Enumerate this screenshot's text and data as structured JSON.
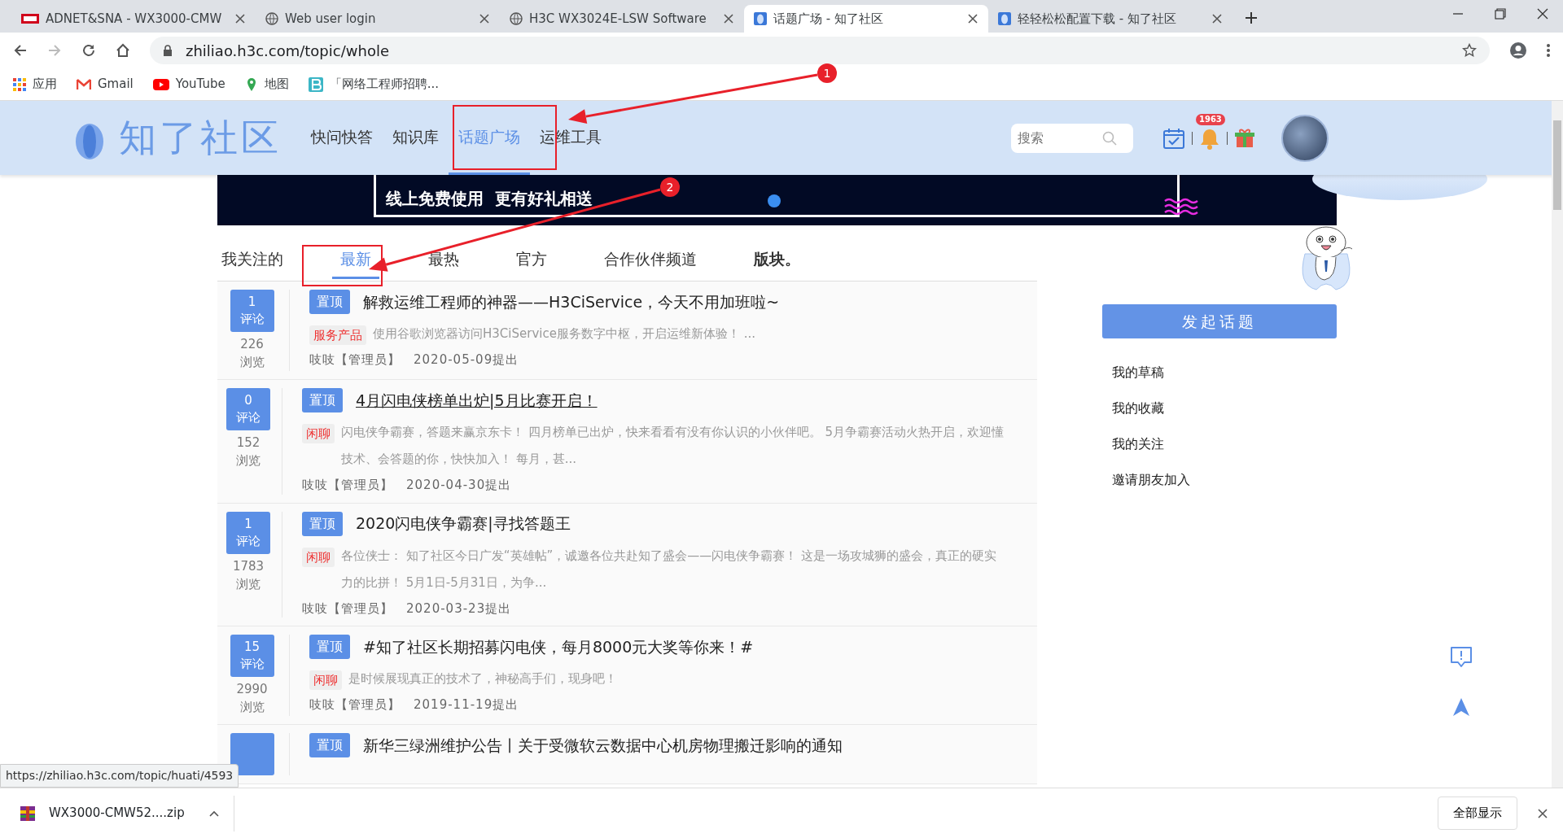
{
  "browser": {
    "tabs": [
      {
        "title": "ADNET&SNA - WX3000-CMW",
        "selected": false
      },
      {
        "title": "Web user login",
        "selected": false
      },
      {
        "title": "H3C WX3024E-LSW Software",
        "selected": false
      },
      {
        "title": "话题广场 - 知了社区",
        "selected": true
      },
      {
        "title": "轻轻松松配置下载 - 知了社区",
        "selected": false
      }
    ],
    "address": "zhiliao.h3c.com/topic/whole",
    "bookmarks": [
      {
        "label": "应用"
      },
      {
        "label": "Gmail"
      },
      {
        "label": "YouTube"
      },
      {
        "label": "地图"
      },
      {
        "label": "「网络工程师招聘..."
      }
    ]
  },
  "header": {
    "logo": "知了社区",
    "nav": [
      {
        "label": "快问快答",
        "selected": false
      },
      {
        "label": "知识库",
        "selected": false
      },
      {
        "label": "话题广场",
        "selected": true
      },
      {
        "label": "运维工具",
        "selected": false
      }
    ],
    "search": {
      "placeholder": "搜索"
    },
    "notification_count": "1963"
  },
  "banner": {
    "text": "线上免费使用  更有好礼相送"
  },
  "topic_tabs": [
    {
      "label": "我关注的",
      "selected": false
    },
    {
      "label": "最新",
      "selected": true
    },
    {
      "label": "最热",
      "selected": false
    },
    {
      "label": "官方",
      "selected": false
    },
    {
      "label": "合作伙伴频道",
      "selected": false
    },
    {
      "label": "版块。",
      "selected": false
    }
  ],
  "topics": [
    {
      "comments": "1",
      "comments_label": "评论",
      "views": "226",
      "views_label": "浏览",
      "pin": "置顶",
      "title": "解救运维工程师的神器——H3CiService，今天不用加班啦~",
      "hovered": false,
      "tag": "服务产品",
      "excerpt": "使用谷歌浏览器访问H3CiService服务数字中枢，开启运维新体验！ ...",
      "author": "吱吱【管理员】",
      "date": "2020-05-09提出"
    },
    {
      "comments": "0",
      "comments_label": "评论",
      "views": "152",
      "views_label": "浏览",
      "pin": "置顶",
      "title": "4月闪电侠榜单出炉|5月比赛开启！",
      "hovered": true,
      "tag": "闲聊",
      "excerpt": "闪电侠争霸赛，答题来赢京东卡！ 四月榜单已出炉，快来看看有没有你认识的小伙伴吧。 5月争霸赛活动火热开启，欢迎懂技术、会答题的你，快快加入！ 每月，甚...",
      "author": "吱吱【管理员】",
      "date": "2020-04-30提出"
    },
    {
      "comments": "1",
      "comments_label": "评论",
      "views": "1783",
      "views_label": "浏览",
      "pin": "置顶",
      "title": "2020闪电侠争霸赛|寻找答题王",
      "hovered": false,
      "tag": "闲聊",
      "excerpt": "各位侠士： 知了社区今日广发“英雄帖”，诚邀各位共赴知了盛会——闪电侠争霸赛！ 这是一场攻城狮的盛会，真正的硬实力的比拼！ 5月1日-5月31日，为争...",
      "author": "吱吱【管理员】",
      "date": "2020-03-23提出"
    },
    {
      "comments": "15",
      "comments_label": "评论",
      "views": "2990",
      "views_label": "浏览",
      "pin": "置顶",
      "title": "#知了社区长期招募闪电侠，每月8000元大奖等你来！#",
      "hovered": false,
      "tag": "闲聊",
      "excerpt": "是时候展现真正的技术了，神秘高手们，现身吧！",
      "author": "吱吱【管理员】",
      "date": "2019-11-19提出"
    },
    {
      "pin": "置顶",
      "title": "新华三绿洲维护公告丨关于受微软云数据中心机房物理搬迁影响的通知",
      "hovered": false
    }
  ],
  "sidebar": {
    "button": "发起话题",
    "links": [
      "我的草稿",
      "我的收藏",
      "我的关注",
      "邀请朋友加入"
    ]
  },
  "status_url": "https://zhiliao.h3c.com/topic/huati/4593",
  "download": {
    "file": "WX3000-CMW52....zip",
    "show_all": "全部显示"
  },
  "annotations": [
    {
      "number": "1"
    },
    {
      "number": "2"
    }
  ]
}
